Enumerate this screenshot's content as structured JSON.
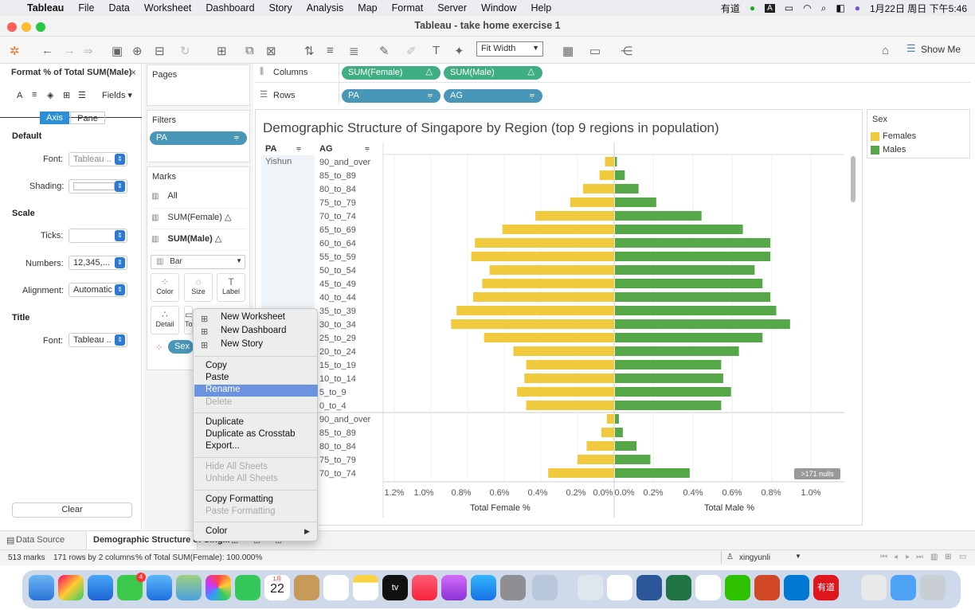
{
  "menubar": {
    "app_name": "Tableau",
    "items": [
      "File",
      "Data",
      "Worksheet",
      "Dashboard",
      "Story",
      "Analysis",
      "Map",
      "Format",
      "Server",
      "Window",
      "Help"
    ],
    "status_right": [
      "有道",
      "1月22日 周日 下午5:46"
    ]
  },
  "window": {
    "title": "Tableau - take home exercise 1"
  },
  "toolbar": {
    "fit_label": "Fit Width",
    "show_me_label": "Show Me"
  },
  "format_panel": {
    "title": "Format % of Total SUM(Male)",
    "fields_label": "Fields",
    "tabs": [
      "Axis",
      "Pane"
    ],
    "sections": {
      "default": "Default",
      "scale": "Scale",
      "title": "Title"
    },
    "rows": {
      "font_label": "Font:",
      "font_value": "Tableau ..",
      "shading_label": "Shading:",
      "ticks_label": "Ticks:",
      "numbers_label": "Numbers:",
      "numbers_value": "12,345,...",
      "alignment_label": "Alignment:",
      "alignment_value": "Automatic",
      "title_font_label": "Font:",
      "title_font_value": "Tableau .."
    },
    "clear_label": "Clear"
  },
  "pages": {
    "title": "Pages"
  },
  "filters": {
    "title": "Filters",
    "pill": "PA"
  },
  "marks": {
    "title": "Marks",
    "rows": [
      "All",
      "SUM(Female)",
      "SUM(Male)"
    ],
    "type": "Bar",
    "buttons": [
      "Color",
      "Size",
      "Label",
      "Detail",
      "To"
    ],
    "sex_pill": "Sex"
  },
  "shelves": {
    "columns_label": "Columns",
    "rows_label": "Rows",
    "column_pills": [
      "SUM(Female)",
      "SUM(Male)"
    ],
    "row_pills": [
      "PA",
      "AG"
    ]
  },
  "legend": {
    "title": "Sex",
    "items": [
      {
        "label": "Females",
        "color": "#f0ca3c"
      },
      {
        "label": "Males",
        "color": "#55a748"
      }
    ]
  },
  "viz": {
    "title": "Demographic Structure of Singapore by Region (top 9 regions in population)",
    "header_pa": "PA",
    "header_ag": "AG",
    "region_label": "Yishun",
    "nulls_badge": ">171 nulls"
  },
  "chart_data": {
    "type": "bar",
    "title": "Demographic Structure of Singapore by Region (top 9 regions in population)",
    "xlabel_left": "Total Female %",
    "xlabel_right": "Total Male %",
    "left_ticks": [
      "1.2%",
      "1.0%",
      "0.8%",
      "0.6%",
      "0.4%",
      "0.2%",
      "0.0%"
    ],
    "right_ticks": [
      "0.0%",
      "0.2%",
      "0.4%",
      "0.6%",
      "0.8%",
      "1.0%"
    ],
    "xlim_left": [
      1.2,
      0
    ],
    "xlim_right": [
      0,
      1.0
    ],
    "block1": {
      "region": "Yishun",
      "categories": [
        "90_and_over",
        "85_to_89",
        "80_to_84",
        "75_to_79",
        "70_to_74",
        "65_to_69",
        "60_to_64",
        "55_to_59",
        "50_to_54",
        "45_to_49",
        "40_to_44",
        "35_to_39",
        "30_to_34",
        "25_to_29",
        "20_to_24",
        "15_to_19",
        "10_to_14",
        "5_to_9",
        "0_to_4"
      ],
      "series": [
        {
          "name": "Females",
          "values": [
            0.05,
            0.08,
            0.17,
            0.24,
            0.43,
            0.61,
            0.76,
            0.78,
            0.68,
            0.72,
            0.77,
            0.86,
            0.89,
            0.71,
            0.55,
            0.48,
            0.49,
            0.53,
            0.48
          ]
        },
        {
          "name": "Males",
          "values": [
            0.01,
            0.05,
            0.12,
            0.21,
            0.44,
            0.65,
            0.79,
            0.79,
            0.71,
            0.75,
            0.79,
            0.82,
            0.89,
            0.75,
            0.63,
            0.54,
            0.55,
            0.59,
            0.54
          ]
        }
      ]
    },
    "block2": {
      "region": "",
      "categories": [
        "90_and_over",
        "85_to_89",
        "80_to_84",
        "75_to_79",
        "70_to_74"
      ],
      "series": [
        {
          "name": "Females",
          "values": [
            0.04,
            0.07,
            0.15,
            0.2,
            0.36
          ]
        },
        {
          "name": "Males",
          "values": [
            0.02,
            0.04,
            0.11,
            0.18,
            0.38
          ]
        }
      ]
    }
  },
  "context_menu": {
    "items": [
      {
        "label": "New Worksheet",
        "enabled": true
      },
      {
        "label": "New Dashboard",
        "enabled": true
      },
      {
        "label": "New Story",
        "enabled": true
      },
      {
        "label": "Copy",
        "enabled": true
      },
      {
        "label": "Paste",
        "enabled": true
      },
      {
        "label": "Rename",
        "enabled": true,
        "highlighted": true
      },
      {
        "label": "Delete",
        "enabled": false
      },
      {
        "label": "Duplicate",
        "enabled": true
      },
      {
        "label": "Duplicate as Crosstab",
        "enabled": true
      },
      {
        "label": "Export...",
        "enabled": true
      },
      {
        "label": "Hide All Sheets",
        "enabled": false
      },
      {
        "label": "Unhide All Sheets",
        "enabled": false
      },
      {
        "label": "Copy Formatting",
        "enabled": true
      },
      {
        "label": "Paste Formatting",
        "enabled": false
      },
      {
        "label": "Color",
        "enabled": true
      }
    ]
  },
  "sheet_tabs": {
    "data_source": "Data Source",
    "active_sheet": "Demographic Structure of Sing..."
  },
  "status": {
    "marks": "513 marks",
    "rows_cols": "171 rows by 2 columns",
    "sum": "% of Total SUM(Female): 100.000%",
    "user": "xingyunli"
  },
  "dock": {
    "calendar_month": "1月",
    "calendar_day": "22",
    "mail_badge": "4",
    "tv_label": "tv",
    "youdao_label": "有道"
  }
}
